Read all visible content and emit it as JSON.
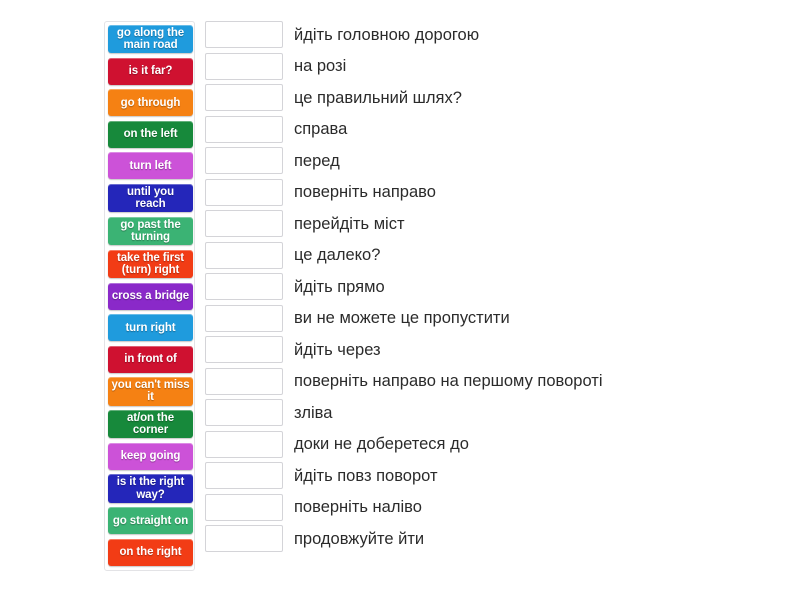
{
  "page": {
    "background_color": "#ffffff",
    "activity_type": "match-up"
  },
  "tiles_panel": {
    "name": "word-tiles-column",
    "border_color": "#e3e3e6",
    "tiles": [
      {
        "label": "go along the main road",
        "color": "#1f9bdd"
      },
      {
        "label": "is it far?",
        "color": "#cf1130"
      },
      {
        "label": "go through",
        "color": "#f58113"
      },
      {
        "label": "on the left",
        "color": "#17893b"
      },
      {
        "label": "turn left",
        "color": "#cc52d8"
      },
      {
        "label": "until you reach",
        "color": "#2426ba"
      },
      {
        "label": "go past the turning",
        "color": "#3bb374"
      },
      {
        "label": "take the first (turn) right",
        "color": "#f23c15"
      },
      {
        "label": "cross a bridge",
        "color": "#8a29c9"
      },
      {
        "label": "turn right",
        "color": "#1f9bdd"
      },
      {
        "label": "in front of",
        "color": "#cf1130"
      },
      {
        "label": "you can't miss it",
        "color": "#f58113"
      },
      {
        "label": "at/on the corner",
        "color": "#17893b"
      },
      {
        "label": "keep going",
        "color": "#cc52d8"
      },
      {
        "label": "is it the right way?",
        "color": "#2426ba"
      },
      {
        "label": "go straight on",
        "color": "#3bb374"
      },
      {
        "label": "on the right",
        "color": "#f23c15"
      }
    ]
  },
  "answers_panel": {
    "name": "answers-column",
    "dropzone_border_color": "#d4d4d8",
    "rows": [
      {
        "answer": "йдіть головною дорогою"
      },
      {
        "answer": "на розі"
      },
      {
        "answer": "це правильний шлях?"
      },
      {
        "answer": "справа"
      },
      {
        "answer": "перед"
      },
      {
        "answer": "поверніть направо"
      },
      {
        "answer": "перейдіть міст"
      },
      {
        "answer": "це далеко?"
      },
      {
        "answer": "йдіть прямо"
      },
      {
        "answer": "ви не можете це пропустити"
      },
      {
        "answer": "йдіть через"
      },
      {
        "answer": "поверніть направо на першому повороті"
      },
      {
        "answer": "зліва"
      },
      {
        "answer": "доки не доберетеся до"
      },
      {
        "answer": "йдіть повз поворот"
      },
      {
        "answer": "поверніть наліво"
      },
      {
        "answer": "продовжуйте йти"
      }
    ]
  }
}
